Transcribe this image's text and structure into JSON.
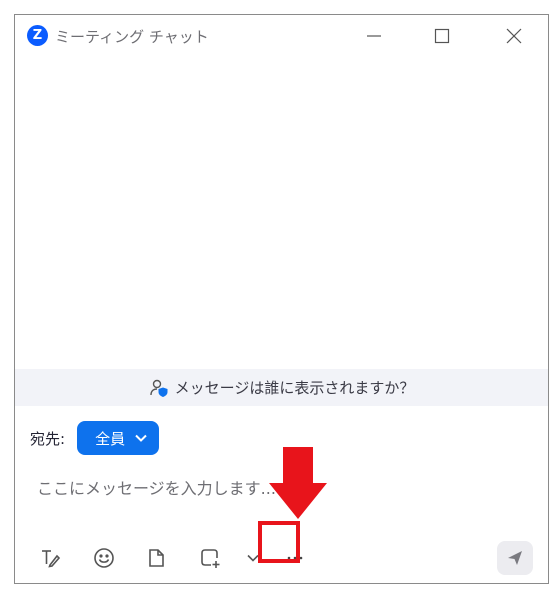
{
  "window": {
    "title": "ミーティング チャット",
    "logo_letter": "Z"
  },
  "visibility": {
    "text": "メッセージは誰に表示されますか？"
  },
  "recipient": {
    "label": "宛先:",
    "selected": "全員"
  },
  "composer": {
    "placeholder": "ここにメッセージを入力します..."
  },
  "toolbar": {
    "icons": [
      "format-icon",
      "emoji-icon",
      "file-icon",
      "screenshot-icon",
      "chevron-down-icon",
      "more-icon",
      "send-icon"
    ]
  },
  "colors": {
    "accent": "#0e72ed",
    "brand": "#0b5cff",
    "annotation": "#e8141b"
  }
}
